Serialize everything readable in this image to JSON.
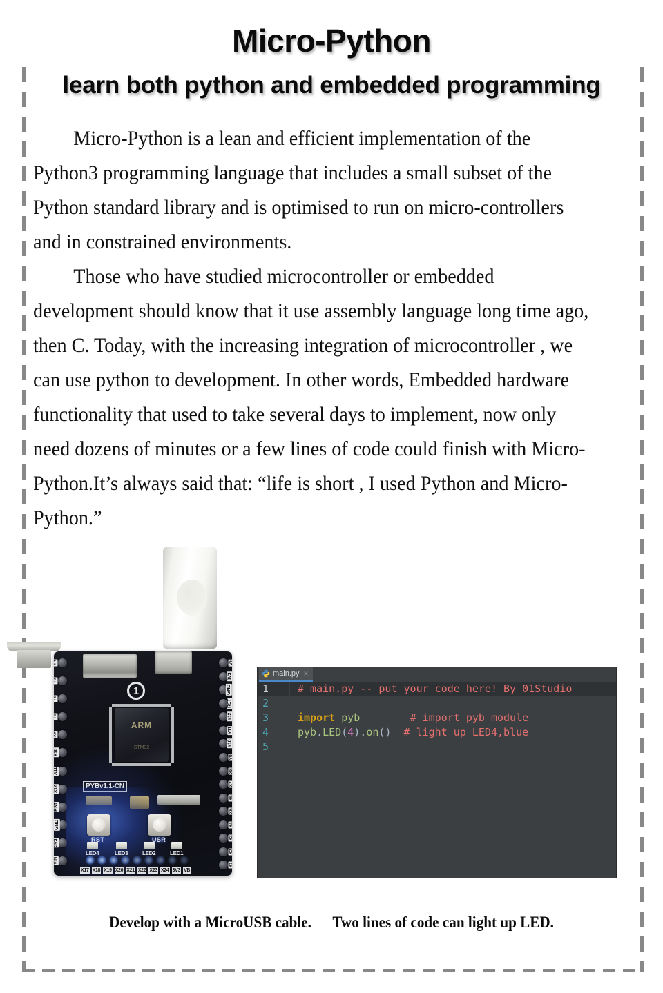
{
  "header": {
    "title": "Micro-Python",
    "subtitle": "learn both python and embedded programming"
  },
  "body": {
    "paragraph1": "Micro-Python is a lean and efficient implementation of the Python3 programming language that includes a small subset of the Python standard library and is optimised to run on micro-controllers and in constrained environments.",
    "paragraph2": "Those who have studied microcontroller or embedded development should know that it use assembly language long time ago, then C. Today, with the increasing integration of microcontroller , we can use python to development. In other words, Embedded hardware functionality that used to take several days to implement, now only need dozens of minutes or a few lines of code could finish with Micro-Python.It’s always said that: “life is short , I used Python and Micro-Python.”"
  },
  "photo": {
    "alt": "pyboard-with-microusb-cable",
    "board_silkscreen": "PYBv1.1-CN",
    "mcu_marking": "ARM",
    "mcu_submarking": "STM32",
    "logo_mark": "1",
    "buttons": [
      {
        "label": "RST"
      },
      {
        "label": "USR"
      }
    ],
    "led_labels": [
      "LED4",
      "LED3",
      "LED2",
      "LED1"
    ],
    "pins_left": [
      "Y4",
      "Y3",
      "Y2",
      "Y1",
      "X9",
      "X10",
      "X11",
      "X12",
      "RST",
      "GND",
      "3V3",
      "VIN"
    ],
    "pins_right": [
      "V+",
      "3V3",
      "GND",
      "RST",
      "Y12",
      "Y11",
      "Y10",
      "Y9",
      "X8",
      "X7",
      "X6",
      "X5",
      "X4",
      "X3",
      "X2",
      "X1"
    ],
    "pins_bottom": [
      "X17",
      "X18",
      "X19",
      "X20",
      "X21",
      "X22",
      "X23",
      "X24",
      "3V3",
      "VB"
    ]
  },
  "editor": {
    "tab": {
      "filename": "main.py",
      "icon": "python-file-icon",
      "close": "×"
    },
    "line_numbers": [
      "1",
      "2",
      "3",
      "4",
      "5"
    ],
    "lines": [
      {
        "current": true,
        "tokens": [
          {
            "type": "comment",
            "text": "# main.py -- put your code here! By 01Studio"
          }
        ]
      },
      {
        "current": false,
        "tokens": []
      },
      {
        "current": false,
        "tokens": [
          {
            "type": "keyword",
            "text": "import"
          },
          {
            "type": "plain",
            "text": " "
          },
          {
            "type": "name",
            "text": "pyb"
          },
          {
            "type": "plain",
            "text": "        "
          },
          {
            "type": "comment",
            "text": "# import pyb module"
          }
        ]
      },
      {
        "current": false,
        "tokens": [
          {
            "type": "name",
            "text": "pyb"
          },
          {
            "type": "plain",
            "text": "."
          },
          {
            "type": "name",
            "text": "LED"
          },
          {
            "type": "plain",
            "text": "("
          },
          {
            "type": "number",
            "text": "4"
          },
          {
            "type": "plain",
            "text": ")."
          },
          {
            "type": "name",
            "text": "on"
          },
          {
            "type": "plain",
            "text": "()  "
          },
          {
            "type": "comment",
            "text": "# light up LED4,blue"
          }
        ]
      },
      {
        "current": false,
        "tokens": []
      }
    ]
  },
  "caption": {
    "left": "Develop with a MicroUSB cable.",
    "right": "Two lines of code can light up LED."
  },
  "colors": {
    "frame_dash": "#888888",
    "editor_bg": "#3c3f41",
    "editor_current_line": "#2f3234",
    "tab_active_underline": "#4a88c7",
    "line_number": "#4fa6b3",
    "comment": "#e4706f",
    "keyword": "#d4a017",
    "identifier": "#a9c47f",
    "number": "#e07bd0",
    "led_glow": "#5a8cff"
  }
}
